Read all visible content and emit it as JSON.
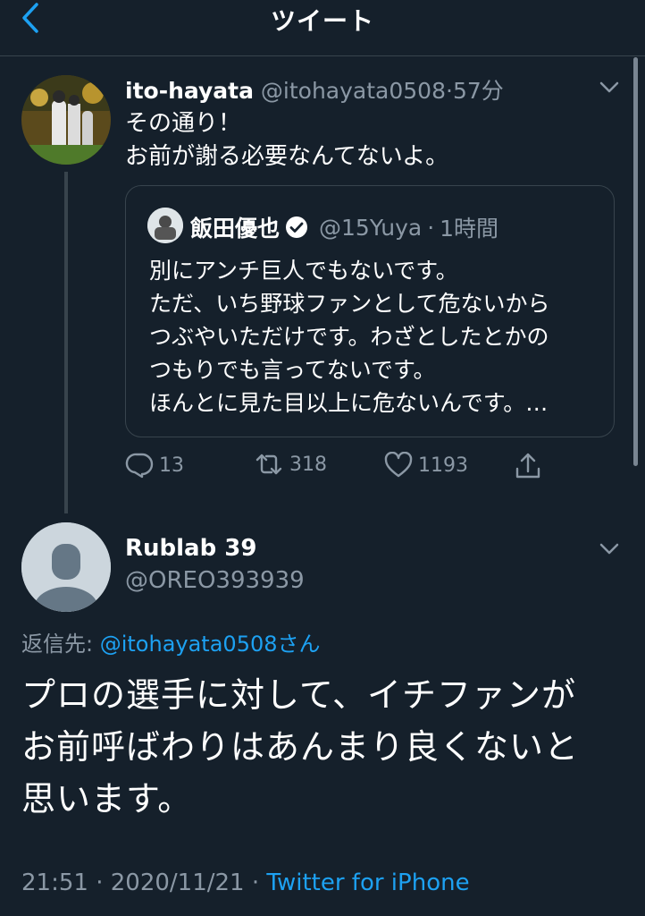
{
  "header": {
    "title": "ツイート"
  },
  "tweet": {
    "name": "ito-hayata",
    "handle": "@itohayata0508",
    "separator": "·",
    "time": "57分",
    "lines": [
      "その通り！",
      "お前が謝る必要なんてないよ。"
    ],
    "quote": {
      "name": "飯田優也",
      "handle": "@15Yuya",
      "separator": "·",
      "time": "1時間",
      "lines": [
        "別にアンチ巨人でもないです。",
        "ただ、いち野球ファンとして危ないから",
        "つぶやいただけです。わざとしたとかの",
        "つもりでも言ってないです。",
        "ほんとに見た目以上に危ないんです。…"
      ]
    },
    "actions": {
      "replies": "13",
      "retweets": "318",
      "likes": "1193"
    }
  },
  "reply": {
    "name": "Rublab 39",
    "handle": "@OREO393939",
    "replying_label": "返信先: ",
    "replying_to": "@itohayata0508さん",
    "lines": [
      "プロの選手に対して、イチファンが",
      "お前呼ばわりはあんまり良くないと",
      "思います。"
    ],
    "time": "21:51",
    "separator1": " · ",
    "date": "2020/11/21",
    "separator2": " · ",
    "client": "Twitter for iPhone"
  },
  "colors": {
    "background": "#15202b",
    "muted": "#8b98a5",
    "link": "#1da1f2",
    "border": "#38444d"
  },
  "icons": [
    "back-chevron-icon",
    "chevron-down-icon",
    "verified-badge-icon",
    "reply-icon",
    "retweet-icon",
    "like-icon",
    "share-icon"
  ]
}
